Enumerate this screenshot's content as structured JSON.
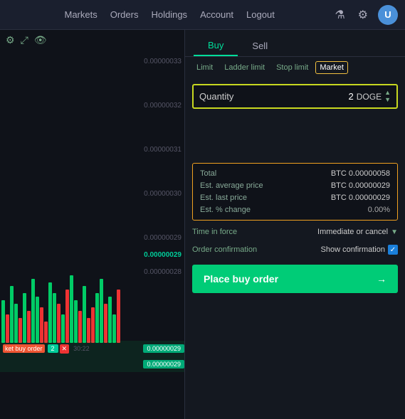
{
  "nav": {
    "links": [
      {
        "label": "Markets",
        "id": "markets"
      },
      {
        "label": "Orders",
        "id": "orders"
      },
      {
        "label": "Holdings",
        "id": "holdings"
      },
      {
        "label": "Account",
        "id": "account"
      },
      {
        "label": "Logout",
        "id": "logout"
      }
    ],
    "icons": {
      "flask": "⚗",
      "gear": "⚙",
      "avatar_initials": "U"
    }
  },
  "chart": {
    "toolbar": {
      "settings_icon": "⚙",
      "expand_icon": "⤢",
      "eye_icon": "👁"
    },
    "price_levels": [
      "0.00000033",
      "0.00000032",
      "0.00000031",
      "0.00000030",
      "0.00000029",
      "0.00000029",
      "0.00000028"
    ],
    "order": {
      "label": "ket buy order",
      "qty": "2",
      "price": "0.00000029",
      "time": "30:22"
    }
  },
  "order_panel": {
    "tabs": {
      "buy_label": "Buy",
      "sell_label": "Sell",
      "active": "buy"
    },
    "order_types": [
      {
        "label": "Limit",
        "id": "limit",
        "active": false
      },
      {
        "label": "Ladder limit",
        "id": "ladder_limit",
        "active": false
      },
      {
        "label": "Stop limit",
        "id": "stop_limit",
        "active": false
      },
      {
        "label": "Market",
        "id": "market",
        "active": true
      }
    ],
    "quantity": {
      "label": "Quantity",
      "value": "2",
      "currency": "DOGE"
    },
    "summary": {
      "total_label": "Total",
      "total_value": "BTC 0.00000058",
      "avg_price_label": "Est. average price",
      "avg_price_value": "BTC 0.00000029",
      "last_price_label": "Est. last price",
      "last_price_value": "BTC 0.00000029",
      "pct_change_label": "Est. % change",
      "pct_change_value": "0.00%"
    },
    "options": {
      "time_in_force_label": "Time in force",
      "time_in_force_value": "Immediate or cancel",
      "order_confirmation_label": "Order confirmation",
      "order_confirmation_value": "Show confirmation"
    },
    "place_order_button": "Place buy order",
    "place_order_arrow": "→"
  }
}
